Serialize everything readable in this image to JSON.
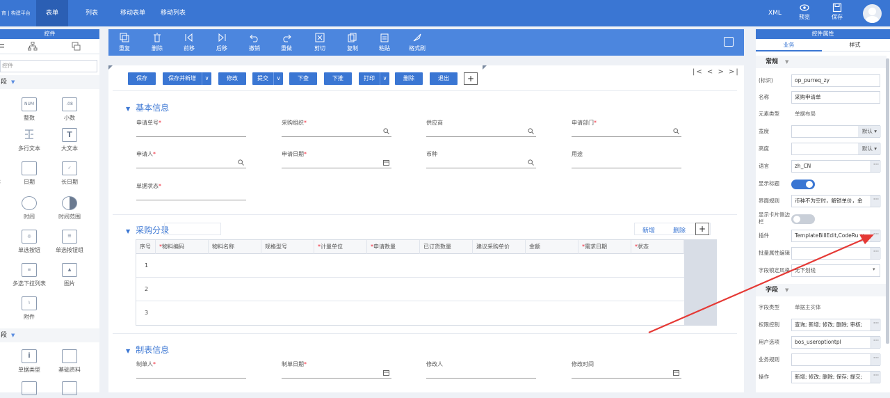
{
  "topbar": {
    "logo": "育 | 构建平台",
    "tabs": [
      {
        "label": "表单",
        "active": true
      },
      {
        "label": "列表",
        "active": false
      },
      {
        "label": "移动表单",
        "active": false
      },
      {
        "label": "移动列表",
        "active": false
      }
    ],
    "xml": "XML",
    "preview": "预览",
    "save": "保存",
    "accent": "#3a76d3"
  },
  "left_panel": {
    "header": "控件",
    "search_placeholder": "控件",
    "group1": "段",
    "group2": "段",
    "controls": [
      {
        "icon": "NUM",
        "label": "整数"
      },
      {
        "icon": ".08",
        "label": "小数"
      },
      {
        "icon": "",
        "label": "多行文本"
      },
      {
        "icon": "T",
        "label": "大文本"
      },
      {
        "icon": "",
        "label": "本"
      },
      {
        "icon": "",
        "label": "日期"
      },
      {
        "icon": "",
        "label": "长日期"
      },
      {
        "icon": "",
        "label": "时间"
      },
      {
        "icon": "",
        "label": "时间范围"
      },
      {
        "icon": "",
        "label": "单选按钮"
      },
      {
        "icon": "",
        "label": "单选按钮组"
      },
      {
        "icon": "",
        "label": "多选下拉列表"
      },
      {
        "icon": "",
        "label": "图片"
      },
      {
        "icon": "",
        "label": "附件"
      },
      {
        "icon": "i",
        "label": "单据类型"
      },
      {
        "icon": "",
        "label": "基础资料"
      }
    ]
  },
  "toolbar": {
    "items": [
      "重复",
      "删除",
      "前移",
      "后移",
      "撤销",
      "重做",
      "剪切",
      "复制",
      "粘贴",
      "格式刷"
    ]
  },
  "form": {
    "buttons": [
      {
        "label": "保存"
      },
      {
        "label": "保存并新增",
        "dd": "∨"
      },
      {
        "label": "修改"
      },
      {
        "label": "提交",
        "dd": "∨"
      },
      {
        "label": "下查"
      },
      {
        "label": "下推"
      },
      {
        "label": "打印",
        "dd": "∨"
      },
      {
        "label": "删除"
      },
      {
        "label": "退出"
      }
    ],
    "plus": "+",
    "nav": "|< < > >|",
    "sections": {
      "basic": "基本信息",
      "entry": "采购分录",
      "maker": "制表信息"
    },
    "basic_fields": [
      {
        "label": "申请单号",
        "req": "*"
      },
      {
        "label": "采购组织",
        "req": "*"
      },
      {
        "label": "供应商",
        "req": ""
      },
      {
        "label": "申请部门",
        "req": "*"
      },
      {
        "label": "申请人",
        "req": "*"
      },
      {
        "label": "申请日期",
        "req": "*"
      },
      {
        "label": "币种",
        "req": ""
      },
      {
        "label": "用途",
        "req": ""
      },
      {
        "label": "单据状态",
        "req": "*"
      }
    ],
    "grid": {
      "add": "新增",
      "delete": "删除",
      "plus": "+",
      "columns": [
        {
          "label": "序号",
          "req": ""
        },
        {
          "label": "物料编码",
          "req": "*"
        },
        {
          "label": "物料名称",
          "req": ""
        },
        {
          "label": "规格型号",
          "req": ""
        },
        {
          "label": "计量单位",
          "req": "*"
        },
        {
          "label": "申请数量",
          "req": "*"
        },
        {
          "label": "已订货数量",
          "req": ""
        },
        {
          "label": "建议采购单价",
          "req": ""
        },
        {
          "label": "金额",
          "req": ""
        },
        {
          "label": "需求日期",
          "req": "*"
        },
        {
          "label": "状态",
          "req": "*"
        }
      ],
      "rows": [
        "1",
        "2",
        "3"
      ]
    },
    "maker_fields": [
      {
        "label": "制单人",
        "req": "*"
      },
      {
        "label": "制单日期",
        "req": "*"
      },
      {
        "label": "修改人",
        "req": ""
      },
      {
        "label": "修改时间",
        "req": ""
      }
    ]
  },
  "right_panel": {
    "header": "控件属性",
    "tabs": [
      {
        "label": "业务",
        "active": true
      },
      {
        "label": "样式",
        "active": false
      }
    ],
    "sec_general": "常规",
    "sec_field": "字段",
    "props": [
      {
        "label": "(标识)",
        "value": "op_purreq_zy"
      },
      {
        "label": "名称",
        "value": "采购申请单"
      },
      {
        "label": "元素类型",
        "text": "单据布局"
      },
      {
        "label": "宽度",
        "value": "",
        "default": "默认 ▾"
      },
      {
        "label": "高度",
        "value": "",
        "default": "默认 ▾"
      },
      {
        "label": "语言",
        "value": "zh_CN"
      },
      {
        "label": "显示标题",
        "toggle": "on"
      },
      {
        "label": "界面规则",
        "value": "币种不为空时，解锁单价，金"
      },
      {
        "label": "显示卡片侧边栏",
        "toggle": "off"
      },
      {
        "label": "插件",
        "value": "TemplateBillEdit,CodeRu ×"
      },
      {
        "label": "批量属性编辑",
        "value": ""
      },
      {
        "label": "字段锁定风格",
        "value": "无下划线"
      }
    ],
    "field_props": [
      {
        "label": "字段类型",
        "text": "单据主实体"
      },
      {
        "label": "权限控制",
        "value": "查询; 新增; 修改; 删除; 审核;"
      },
      {
        "label": "用户选项",
        "value": "bos_useroptiontpl"
      },
      {
        "label": "业务规则",
        "value": ""
      },
      {
        "label": "操作",
        "value": "新增; 修改; 删除; 保存; 提交;"
      }
    ],
    "ellipsis": "···"
  },
  "annotation": {
    "color": "#e53935"
  }
}
